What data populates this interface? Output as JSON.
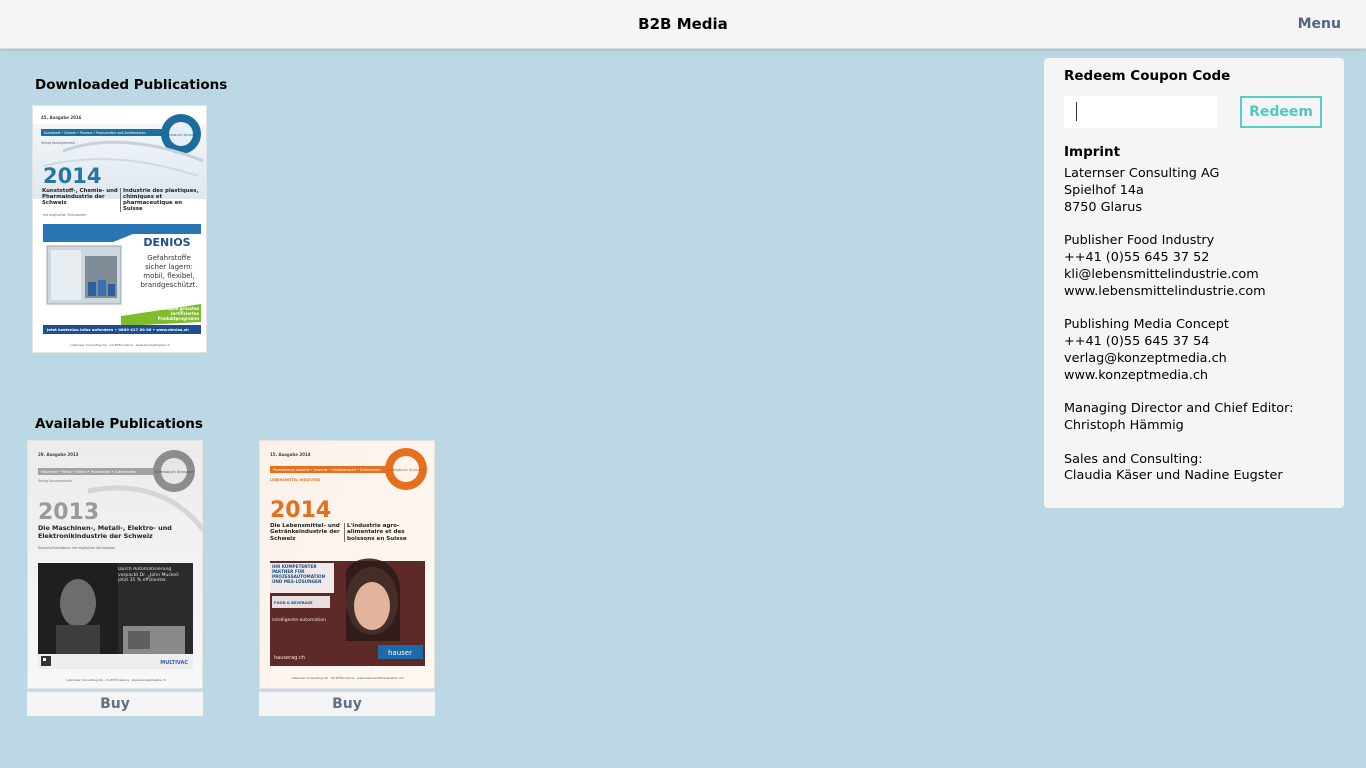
{
  "header": {
    "title": "B2B Media",
    "menu_label": "Menu"
  },
  "downloaded": {
    "title": "Downloaded Publications",
    "items": [
      {
        "edition": "45. Ausgabe 2016",
        "year": "2014",
        "topbar": "Kunststoff • Chemie • Pharma • Produzenten und Zulieferanten",
        "publisher": "Verlag Konzeptmedia",
        "headline_de": "Kunststoff-, Chemie- und Pharmaindustrie der Schweiz",
        "headline_fr": "Industrie des plastiques, chimiques et pharmaceutique en Suisse",
        "subline": "mit englischen Stichworten",
        "badge": "Adressbuch Annuaire",
        "ad_brand": "DENIOS",
        "ad_slogan": "Gefahrstoffe sicher lagern: mobil, flexibel, brandgeschützt.",
        "ad_green": "Europas grösstes zertifiziertes Produktprogramm",
        "ad_bar": "Jetzt kostenlos Infos anfordern • 0800 417 00 00 • www.denios.ch",
        "footer": "Laternser Consulting AG · Ch-8750 Glarus · www.konzeptmedia.ch"
      }
    ]
  },
  "available": {
    "title": "Available Publications",
    "items": [
      {
        "edition": "29. Ausgabe 2013",
        "year": "2013",
        "topbar": "Maschinen • Metall • Elektro • Produzenten • Zulieferanten",
        "publisher": "Verlag Konzeptmedia",
        "headline": "Die Maschinen-, Metall-, Elektro- und Elektronikindustrie der Schweiz",
        "subline": "Deutsch/Französisch mit englischen Stichworten",
        "ad_text": "Durch Automatisierung verpackt Dr. „John Muckeli jetzt 35 % effizienter.",
        "ad_brand": "MULTIVAC",
        "badge": "Adressbuch Annuaire",
        "footer": "Laternser Consulting AG · Ch-8750 Glarus · www.konzeptmedia.ch",
        "buy_label": "Buy"
      },
      {
        "edition": "15. Ausgabe 2014",
        "year": "2014",
        "topbar": "Produzierende Industrie • Gewerbe • Getränkehandel • Zulieferanten",
        "publisher": "LEBENSMITTEL INDUSTRIE",
        "headline_de": "Die Lebensmittel- und Getränkeindustrie der Schweiz",
        "headline_fr": "L'industrie agro-alimentaire et des boissons en Suisse",
        "ad_l1": "IHR KOMPETENTER PARTNER FÜR PROZESSAUTOMATION UND MES-LÖSUNGEN",
        "ad_l2": "FOOD & BEVERAGE",
        "ad_l3": "intelligente-automation",
        "ad_brand": "hauser",
        "ad_url": "hauserag.ch",
        "badge": "Adressbuch Annuaire",
        "footer": "Laternser Consulting AG · Ch-8750 Glarus · www.lebensmittelindustrie.com",
        "buy_label": "Buy"
      }
    ]
  },
  "coupon": {
    "title": "Redeem Coupon Code",
    "value": "",
    "placeholder": "",
    "button_label": "Redeem"
  },
  "imprint": {
    "title": "Imprint",
    "blocks": [
      [
        "Laternser Consulting AG",
        "Spielhof 14a",
        "8750 Glarus"
      ],
      [
        "Publisher Food Industry",
        "++41 (0)55 645 37 52",
        "kli@lebensmittelindustrie.com",
        "www.lebensmittelindustrie.com"
      ],
      [
        "Publishing Media Concept",
        "++41 (0)55 645 37 54",
        "verlag@konzeptmedia.ch",
        "www.konzeptmedia.ch"
      ],
      [
        "Managing Director and Chief Editor:",
        "Christoph Hämmig"
      ],
      [
        "Sales and Consulting:",
        "Claudia Käser und Nadine Eugster"
      ]
    ]
  },
  "colors": {
    "background": "#bcd8e5",
    "accent": "#54d0c6",
    "menu": "#4e6680",
    "cover_blue": "#2474a6",
    "cover_orange": "#e4701e"
  }
}
